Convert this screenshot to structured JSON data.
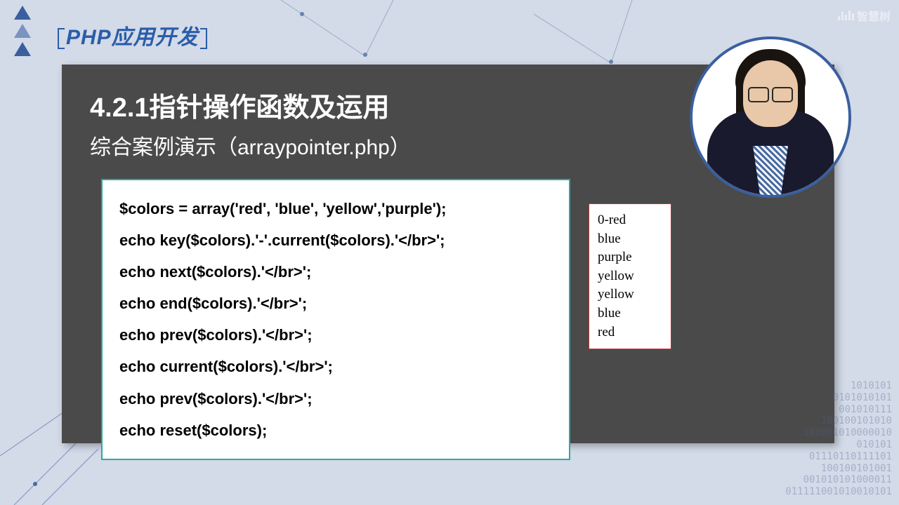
{
  "header": {
    "title": "PHP应用开发"
  },
  "watermark": {
    "text": "智慧树"
  },
  "slide": {
    "title": "4.2.1指针操作函数及运用",
    "subtitle": "综合案例演示（arraypointer.php）"
  },
  "code": {
    "lines": [
      "$colors = array('red', 'blue', 'yellow','purple');",
      "echo key($colors).'-'.current($colors).'</br>';",
      "echo next($colors).'</br>';",
      "echo end($colors).'</br>';",
      "echo prev($colors).'</br>';",
      "echo current($colors).'</br>';",
      "echo prev($colors).'</br>';",
      "echo reset($colors);"
    ]
  },
  "output": {
    "lines": [
      "0-red",
      "blue",
      "purple",
      "yellow",
      "yellow",
      "blue",
      "red"
    ]
  },
  "binary": "1010101\n0101010101\n001010111\n100100101010\n100001010000010\n010101\n01110110111101\n100100101001\n001010101000011\n011111001010010101"
}
